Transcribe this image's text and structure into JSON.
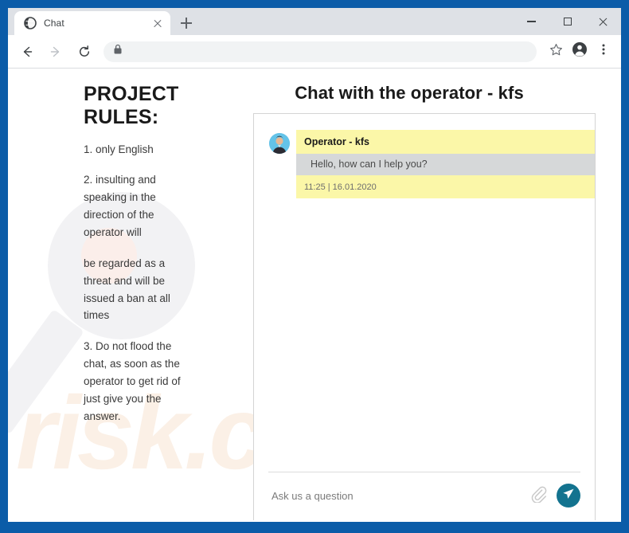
{
  "browser": {
    "tab": {
      "title": "Chat",
      "favicon": "globe-icon",
      "close_label": "Close tab"
    },
    "new_tab_label": "New tab",
    "window_controls": {
      "minimize": "Minimize",
      "maximize": "Maximize",
      "close": "Close"
    },
    "toolbar": {
      "back": "Back",
      "forward": "Forward",
      "reload": "Reload",
      "url": "",
      "lock": "lock-icon",
      "bookmark": "Bookmark this page",
      "profile": "Profile",
      "menu": "Customize and control"
    }
  },
  "page": {
    "rules": {
      "title": "PROJECT RULES:",
      "items": [
        "1. only English",
        "2. insulting and speaking in the direction of the operator will",
        "be regarded as a threat and will be issued a ban at all times",
        "3. Do not flood the chat, as soon as the operator to get rid of just give you the answer."
      ]
    },
    "chat": {
      "heading": "Chat with the operator - kfs",
      "messages": [
        {
          "author": "Operator - kfs",
          "text": "Hello, how can I help you?",
          "time": "11:25 | 16.01.2020",
          "avatar": "operator-avatar"
        }
      ],
      "composer": {
        "placeholder": "Ask us a question",
        "value": "",
        "attach_label": "Attach file",
        "send_label": "Send"
      }
    },
    "watermark": {
      "logo": "PC",
      "domain": "risk.com"
    }
  },
  "colors": {
    "window_frame": "#0b5ca8",
    "tabstrip": "#dee1e6",
    "highlight_yellow": "#fbf7a8",
    "bubble_gray": "#d6d8d9",
    "send_button": "#13738f"
  }
}
